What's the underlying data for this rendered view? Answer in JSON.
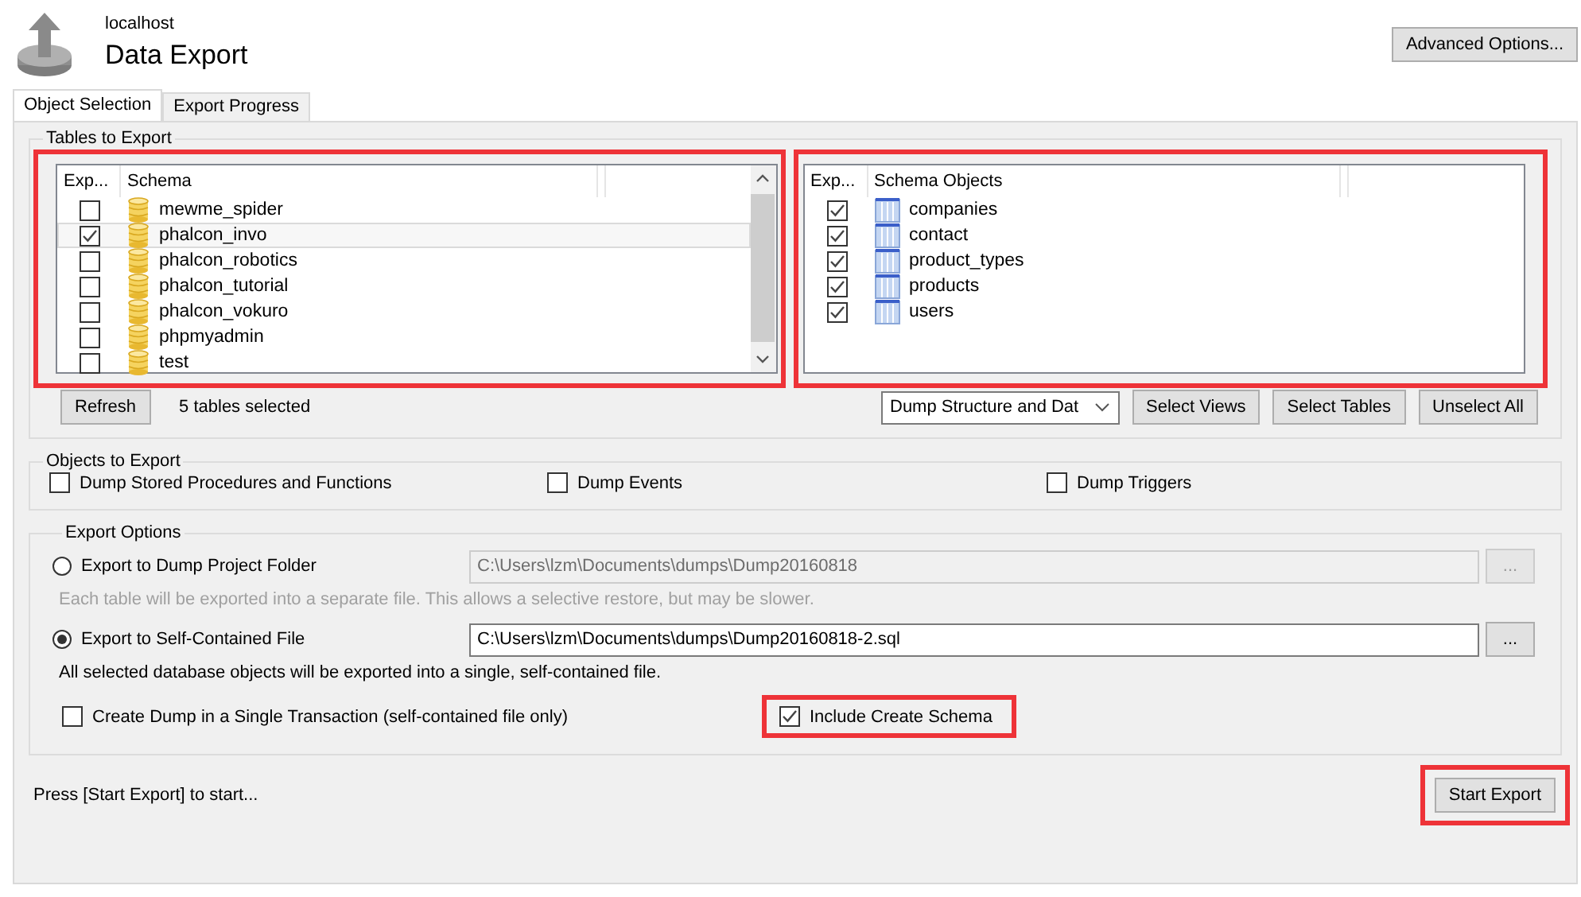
{
  "header": {
    "subtitle": "localhost",
    "title": "Data Export",
    "advanced_button": "Advanced Options..."
  },
  "tabs": [
    {
      "label": "Object Selection",
      "selected": true
    },
    {
      "label": "Export Progress",
      "selected": false
    }
  ],
  "tables_to_export": {
    "title": "Tables to Export",
    "schema_list": {
      "highlighted": true,
      "columns": [
        "Exp...",
        "Schema"
      ],
      "rows": [
        {
          "name": "mewme_spider",
          "checked": false,
          "selected": false
        },
        {
          "name": "phalcon_invo",
          "checked": true,
          "selected": true
        },
        {
          "name": "phalcon_robotics",
          "checked": false,
          "selected": false
        },
        {
          "name": "phalcon_tutorial",
          "checked": false,
          "selected": false
        },
        {
          "name": "phalcon_vokuro",
          "checked": false,
          "selected": false
        },
        {
          "name": "phpmyadmin",
          "checked": false,
          "selected": false
        },
        {
          "name": "test",
          "checked": false,
          "selected": false
        }
      ]
    },
    "objects_list": {
      "highlighted": true,
      "columns": [
        "Exp...",
        "Schema Objects"
      ],
      "rows": [
        {
          "name": "companies",
          "checked": true
        },
        {
          "name": "contact",
          "checked": true
        },
        {
          "name": "product_types",
          "checked": true
        },
        {
          "name": "products",
          "checked": true
        },
        {
          "name": "users",
          "checked": true
        }
      ]
    },
    "refresh_button": "Refresh",
    "selection_count": "5 tables selected",
    "dump_mode": "Dump Structure and Dat",
    "buttons": [
      "Select Views",
      "Select Tables",
      "Unselect All"
    ]
  },
  "objects_to_export": {
    "title": "Objects to Export",
    "options": [
      {
        "label": "Dump Stored Procedures and Functions",
        "checked": false
      },
      {
        "label": "Dump Events",
        "checked": false
      },
      {
        "label": "Dump Triggers",
        "checked": false
      }
    ]
  },
  "export_options": {
    "title": "Export Options",
    "targets": [
      {
        "label": "Export to Dump Project Folder",
        "selected": false,
        "disabled": true,
        "path": "C:\\Users\\lzm\\Documents\\dumps\\Dump20160818",
        "browse": "...",
        "note": "Each table will be exported into a separate file. This allows a selective restore, but may be slower."
      },
      {
        "label": "Export to Self-Contained File",
        "selected": true,
        "disabled": false,
        "path": "C:\\Users\\lzm\\Documents\\dumps\\Dump20160818-2.sql",
        "browse": "...",
        "note": "All selected database objects will be exported into a single, self-contained file."
      }
    ],
    "single_transaction": {
      "label": "Create Dump in a Single Transaction (self-contained file only)",
      "checked": false
    },
    "include_create_schema": {
      "label": "Include Create Schema",
      "checked": true,
      "highlighted": true
    }
  },
  "status": "Press [Start Export] to start...",
  "start_button": {
    "label": "Start Export",
    "highlighted": true
  }
}
